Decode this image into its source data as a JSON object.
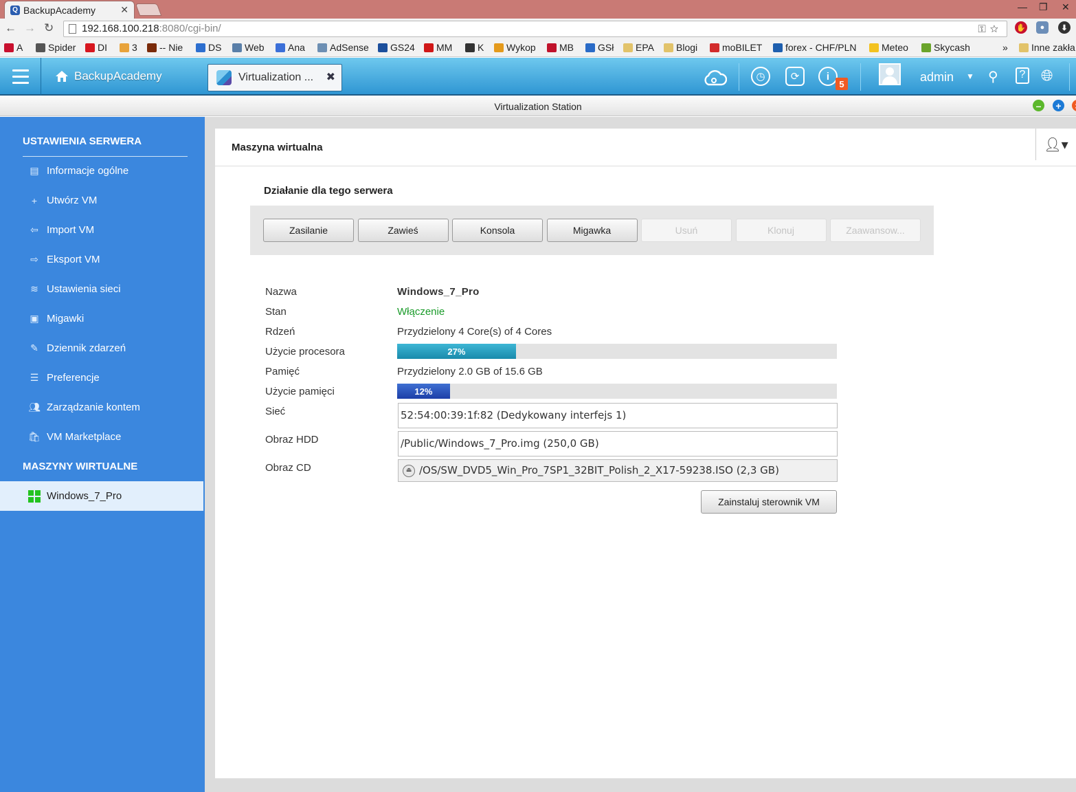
{
  "browser": {
    "tab_title": "BackupAcademy",
    "tab_favicon": "Q",
    "url_host": "192.168.100.218",
    "url_rest": ":8080/cgi-bin/",
    "bookmarks": [
      {
        "label": "A",
        "color": "#c8102e"
      },
      {
        "label": "Spider",
        "color": "#555555"
      },
      {
        "label": "DI",
        "color": "#d7171f"
      },
      {
        "label": "3",
        "color": "#e8a33b"
      },
      {
        "label": "-- Nie",
        "color": "#7a2b0a"
      },
      {
        "label": "DS",
        "color": "#2d6fcf"
      },
      {
        "label": "Web",
        "color": "#5a7fa8"
      },
      {
        "label": "Ana",
        "color": "#3b6fd8"
      },
      {
        "label": "AdSense",
        "color": "#6d8fb3"
      },
      {
        "label": "GS24",
        "color": "#1c4f9c"
      },
      {
        "label": "MM",
        "color": "#d01818"
      },
      {
        "label": "K",
        "color": "#333333"
      },
      {
        "label": "Wykop",
        "color": "#e49a1c"
      },
      {
        "label": "MB",
        "color": "#c0122b"
      },
      {
        "label": "GSł",
        "color": "#2a6bc7"
      },
      {
        "label": "EPA",
        "color": "#e2c36a"
      },
      {
        "label": "Blogi",
        "color": "#e2c36a"
      },
      {
        "label": "moBILET",
        "color": "#d22b2b"
      },
      {
        "label": "forex - CHF/PLN",
        "color": "#1e5fae"
      },
      {
        "label": "Meteo",
        "color": "#f3c220"
      },
      {
        "label": "Skycash",
        "color": "#6aa42b"
      },
      {
        "label": "Inne zakła",
        "color": "#e2c36a"
      }
    ],
    "bookmarks_overflow": "»"
  },
  "app_header": {
    "home_label": "BackupAcademy",
    "app_tab_label": "Virtualization ...",
    "notifications_badge": "5",
    "user": "admin",
    "icons": [
      "menu-icon",
      "home-icon",
      "cloud-icon",
      "clock-icon",
      "sync-icon",
      "info-icon",
      "avatar-icon",
      "search-icon",
      "help-icon",
      "globe-icon"
    ]
  },
  "window": {
    "title": "Virtualization Station"
  },
  "sidebar": {
    "section1": "USTAWIENIA SERWERA",
    "items": [
      {
        "label": "Informacje ogólne",
        "icon": "info-list-icon"
      },
      {
        "label": "Utwórz VM",
        "icon": "plus-icon"
      },
      {
        "label": "Import VM",
        "icon": "import-icon"
      },
      {
        "label": "Eksport VM",
        "icon": "export-icon"
      },
      {
        "label": "Ustawienia sieci",
        "icon": "network-icon"
      },
      {
        "label": "Migawki",
        "icon": "camera-icon"
      },
      {
        "label": "Dziennik zdarzeń",
        "icon": "log-icon"
      },
      {
        "label": "Preferencje",
        "icon": "preferences-icon"
      },
      {
        "label": "Zarządzanie kontem",
        "icon": "account-icon"
      },
      {
        "label": "VM Marketplace",
        "icon": "marketplace-icon"
      }
    ],
    "section2": "MASZYNY WIRTUALNE",
    "vms": [
      {
        "label": "Windows_7_Pro",
        "icon": "windows-icon",
        "selected": true
      }
    ]
  },
  "main": {
    "panel_title": "Maszyna wirtualna",
    "actions_title": "Działanie dla tego serwera",
    "actions": [
      {
        "label": "Zasilanie",
        "enabled": true
      },
      {
        "label": "Zawieś",
        "enabled": true
      },
      {
        "label": "Konsola",
        "enabled": true
      },
      {
        "label": "Migawka",
        "enabled": true
      },
      {
        "label": "Usuń",
        "enabled": false
      },
      {
        "label": "Klonuj",
        "enabled": false
      },
      {
        "label": "Zaawansow...",
        "enabled": false
      }
    ],
    "details": {
      "name_label": "Nazwa",
      "name_value": "Windows_7_Pro",
      "state_label": "Stan",
      "state_value": "Włączenie",
      "state_color": "#1a9b2a",
      "core_label": "Rdzeń",
      "core_value": "Przydzielony 4 Core(s) of 4 Cores",
      "cpu_label": "Użycie procesora",
      "cpu_percent": 27,
      "cpu_text": "27%",
      "memory_label": "Pamięć",
      "memory_value": "Przydzielony 2.0 GB of 15.6 GB",
      "mem_usage_label": "Użycie pamięci",
      "mem_percent": 12,
      "mem_text": "12%",
      "network_label": "Sieć",
      "network_value": "52:54:00:39:1f:82 (Dedykowany interfejs 1)",
      "hdd_label": "Obraz HDD",
      "hdd_value": "/Public/Windows_7_Pro.img (250,0 GB)",
      "cd_label": "Obraz CD",
      "cd_value": "/OS/SW_DVD5_Win_Pro_7SP1_32BIT_Polish_2_X17-59238.ISO (2,3 GB)"
    },
    "install_button": "Zainstaluj sterownik VM"
  }
}
